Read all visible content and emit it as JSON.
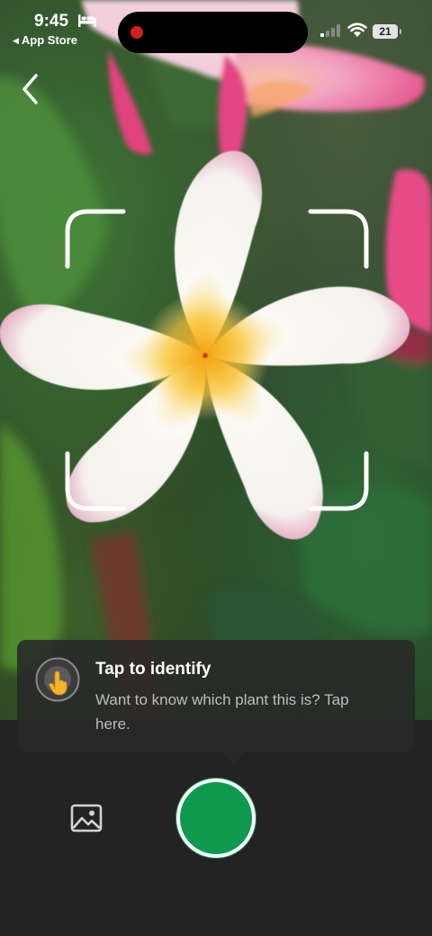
{
  "status_bar": {
    "time": "9:45",
    "back_app_label": "App Store",
    "battery_level": "21",
    "icons": [
      "bed-icon",
      "signal-icon",
      "wifi-icon",
      "battery-icon"
    ]
  },
  "header": {
    "back_icon": "chevron-left-icon"
  },
  "camera": {
    "subject": "frangipani-flower",
    "scan_frame": "corner-brackets"
  },
  "tooltip": {
    "icon": "tap-hand-icon",
    "title": "Tap to identify",
    "body": "Want to know which plant this is? Tap here."
  },
  "controls": {
    "gallery_icon": "image-gallery-icon",
    "shutter": "shutter-button",
    "shutter_color": "#0d9a4f"
  },
  "colors": {
    "accent": "#0d9a4f",
    "recording_dot": "#d0211f",
    "panel_bg": "#232323"
  }
}
